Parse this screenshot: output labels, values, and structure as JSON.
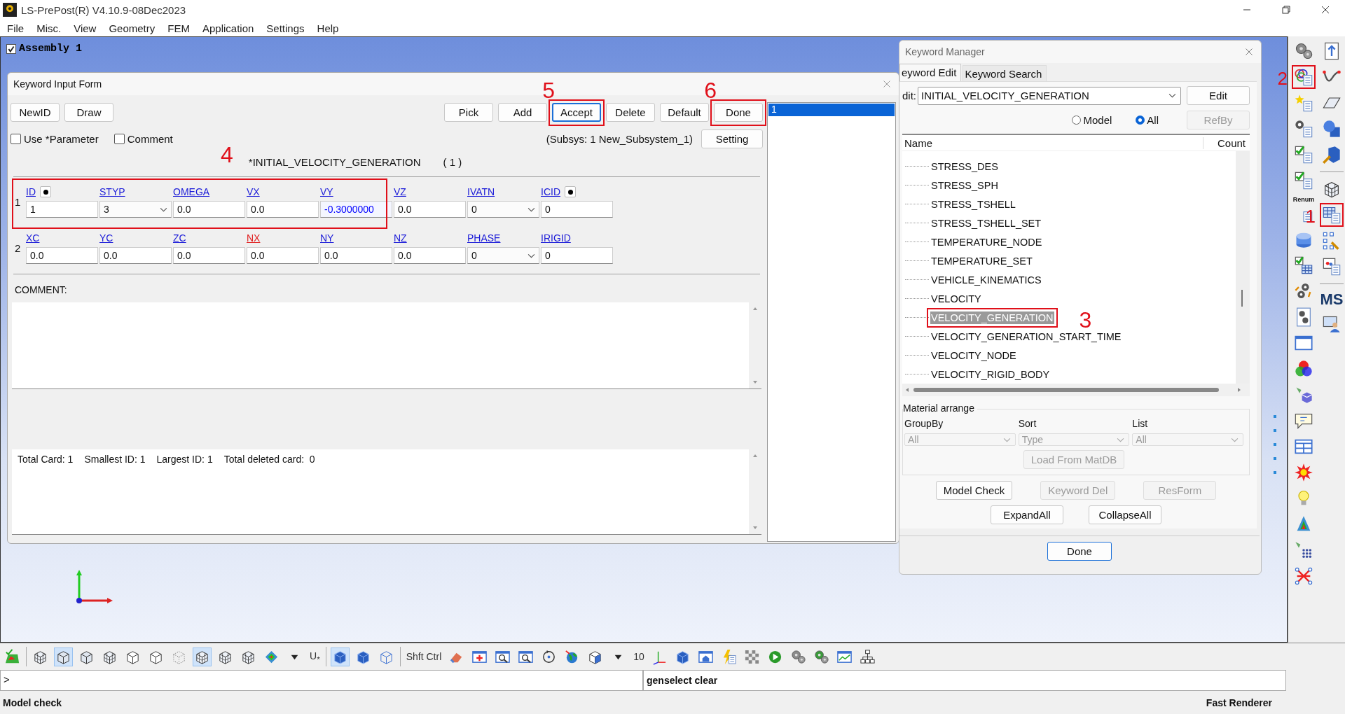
{
  "window": {
    "title": "LS-PrePost(R) V4.10.9-08Dec2023"
  },
  "menu": [
    "File",
    "Misc.",
    "View",
    "Geometry",
    "FEM",
    "Application",
    "Settings",
    "Help"
  ],
  "assembly_tree": {
    "label": "Assembly 1",
    "checked": true
  },
  "keyword_input_form": {
    "title": "Keyword Input Form",
    "left_buttons": [
      {
        "label": "NewID"
      },
      {
        "label": "Draw"
      }
    ],
    "action_buttons": [
      {
        "label": "Pick",
        "focused": false
      },
      {
        "label": "Add",
        "focused": false
      },
      {
        "label": "Accept",
        "focused": true,
        "callout": "5"
      },
      {
        "label": "Delete",
        "focused": false
      },
      {
        "label": "Default",
        "focused": false
      },
      {
        "label": "Done",
        "focused": false,
        "callout": "6"
      }
    ],
    "options": [
      {
        "label": "Use *Parameter",
        "checked": false
      },
      {
        "label": "Comment",
        "checked": false
      }
    ],
    "subsystem": "(Subsys: 1 New_Subsystem_1)",
    "setting_button": "Setting",
    "keyword_title": "*INITIAL_VELOCITY_GENERATION",
    "keyword_count": "( 1 )",
    "cards_callout": "4",
    "cards": [
      {
        "number": "1",
        "fields": [
          {
            "name": "ID",
            "kind": "text",
            "value": "1",
            "pick": true,
            "required": false,
            "modified": false
          },
          {
            "name": "STYP",
            "kind": "select",
            "value": "3",
            "pick": false,
            "required": false,
            "modified": false
          },
          {
            "name": "OMEGA",
            "kind": "text",
            "value": "0.0",
            "pick": false,
            "required": false,
            "modified": false
          },
          {
            "name": "VX",
            "kind": "text",
            "value": "0.0",
            "pick": false,
            "required": false,
            "modified": false
          },
          {
            "name": "VY",
            "kind": "text",
            "value": "-0.3000000",
            "pick": false,
            "required": false,
            "modified": true
          },
          {
            "name": "VZ",
            "kind": "text",
            "value": "0.0",
            "pick": false,
            "required": false,
            "modified": false
          },
          {
            "name": "IVATN",
            "kind": "select",
            "value": "0",
            "pick": false,
            "required": false,
            "modified": false
          },
          {
            "name": "ICID",
            "kind": "text",
            "value": "0",
            "pick": true,
            "required": false,
            "modified": false
          }
        ]
      },
      {
        "number": "2",
        "fields": [
          {
            "name": "XC",
            "kind": "text",
            "value": "0.0",
            "pick": false,
            "required": false,
            "modified": false
          },
          {
            "name": "YC",
            "kind": "text",
            "value": "0.0",
            "pick": false,
            "required": false,
            "modified": false
          },
          {
            "name": "ZC",
            "kind": "text",
            "value": "0.0",
            "pick": false,
            "required": false,
            "modified": false
          },
          {
            "name": "NX",
            "kind": "text",
            "value": "0.0",
            "pick": false,
            "required": true,
            "modified": false
          },
          {
            "name": "NY",
            "kind": "text",
            "value": "0.0",
            "pick": false,
            "required": false,
            "modified": false
          },
          {
            "name": "NZ",
            "kind": "text",
            "value": "0.0",
            "pick": false,
            "required": false,
            "modified": false
          },
          {
            "name": "PHASE",
            "kind": "select",
            "value": "0",
            "pick": false,
            "required": false,
            "modified": false
          },
          {
            "name": "IRIGID",
            "kind": "text",
            "value": "0",
            "pick": false,
            "required": false,
            "modified": false
          }
        ]
      }
    ],
    "comment_label": "COMMENT:",
    "summary": [
      "Total Card: 1",
      "Smallest ID: 1",
      "Largest ID: 1",
      "Total deleted card:  0"
    ],
    "id_list": [
      {
        "label": "1",
        "selected": true
      }
    ]
  },
  "keyword_manager": {
    "title": "Keyword Manager",
    "tabs": [
      {
        "label": "eyword Edit",
        "selected": true
      },
      {
        "label": "Keyword Search",
        "selected": false
      }
    ],
    "edit_label": "dit:",
    "edit_value": "INITIAL_VELOCITY_GENERATION",
    "edit_button": "Edit",
    "scope": [
      {
        "label": "Model",
        "selected": false
      },
      {
        "label": "All",
        "selected": true
      }
    ],
    "refby_button": {
      "label": "RefBy",
      "disabled": true
    },
    "columns": [
      "Name",
      "Count"
    ],
    "items": [
      {
        "name": "STRESS_DES",
        "selected": false
      },
      {
        "name": "STRESS_SPH",
        "selected": false
      },
      {
        "name": "STRESS_TSHELL",
        "selected": false
      },
      {
        "name": "STRESS_TSHELL_SET",
        "selected": false
      },
      {
        "name": "TEMPERATURE_NODE",
        "selected": false
      },
      {
        "name": "TEMPERATURE_SET",
        "selected": false
      },
      {
        "name": "VEHICLE_KINEMATICS",
        "selected": false
      },
      {
        "name": "VELOCITY",
        "selected": false
      },
      {
        "name": "VELOCITY_GENERATION",
        "selected": true,
        "callout": "3"
      },
      {
        "name": "VELOCITY_GENERATION_START_TIME",
        "selected": false
      },
      {
        "name": "VELOCITY_NODE",
        "selected": false
      },
      {
        "name": "VELOCITY_RIGID_BODY",
        "selected": false
      }
    ],
    "material_arrange": {
      "title": "Material arrange",
      "filters": [
        {
          "label": "GroupBy",
          "value": "All",
          "disabled": true
        },
        {
          "label": "Sort",
          "value": "Type",
          "disabled": true
        },
        {
          "label": "List",
          "value": "All",
          "disabled": true
        }
      ],
      "load_button": {
        "label": "Load From MatDB",
        "disabled": true
      }
    },
    "button_rows": [
      [
        {
          "label": "Model Check",
          "disabled": false
        },
        {
          "label": "Keyword Del",
          "disabled": true
        },
        {
          "label": "ResForm",
          "disabled": true
        }
      ],
      [
        {
          "label": "ExpandAll",
          "disabled": false
        },
        {
          "label": "CollapseAll",
          "disabled": false
        }
      ]
    ],
    "done_button": "Done"
  },
  "right_toolbar": {
    "column_1": [
      {
        "kind": "gears"
      },
      {
        "kind": "circles-list",
        "callout": "2"
      },
      {
        "kind": "star-list"
      },
      {
        "kind": "gear-list"
      },
      {
        "kind": "check-list"
      },
      {
        "kind": "check-list"
      },
      {
        "kind": "renum",
        "label": "Renum"
      },
      {
        "kind": "cylinder"
      },
      {
        "kind": "check-grid"
      },
      {
        "kind": "gears-arrows"
      },
      {
        "kind": "gears-panel"
      },
      {
        "kind": "window"
      },
      {
        "kind": "rgb"
      },
      {
        "kind": "lamp-cube"
      },
      {
        "kind": "bubble"
      },
      {
        "kind": "split-window"
      },
      {
        "kind": "explosion"
      },
      {
        "kind": "bulb"
      },
      {
        "kind": "triangle"
      },
      {
        "kind": "lamp-grid"
      },
      {
        "kind": "x-nodes"
      }
    ],
    "column_2": [
      {
        "kind": "up-doc"
      },
      {
        "kind": "curve"
      },
      {
        "kind": "plane"
      },
      {
        "kind": "sphere-cube"
      },
      {
        "kind": "cube-wrench"
      },
      {
        "kind": "separator"
      },
      {
        "kind": "mesh-cube"
      },
      {
        "kind": "table-list",
        "callout": "1"
      },
      {
        "kind": "node-wrench"
      },
      {
        "kind": "photo-list"
      },
      {
        "kind": "separator"
      },
      {
        "kind": "label",
        "label": "MS"
      },
      {
        "kind": "person-screen"
      }
    ]
  },
  "bottom_toolbar": [
    {
      "kind": "surface",
      "selected": false
    },
    {
      "kind": "separator"
    },
    {
      "kind": "mesh-cube",
      "selected": false
    },
    {
      "kind": "shaded-cube",
      "selected": true
    },
    {
      "kind": "shaded-cube",
      "selected": false
    },
    {
      "kind": "mesh-cube",
      "selected": false
    },
    {
      "kind": "outline-cube",
      "selected": false
    },
    {
      "kind": "outline-cube",
      "selected": false
    },
    {
      "kind": "dots-cube",
      "selected": false
    },
    {
      "kind": "mesh-cube",
      "selected": true
    },
    {
      "kind": "mesh-cube",
      "selected": false
    },
    {
      "kind": "mesh-cube",
      "selected": false
    },
    {
      "kind": "fringe",
      "selected": false
    },
    {
      "kind": "caret",
      "selected": false
    },
    {
      "kind": "label",
      "label": "U$_{*}$",
      "selected": false
    },
    {
      "kind": "separator"
    },
    {
      "kind": "blue-cube",
      "selected": true
    },
    {
      "kind": "blue-cube",
      "selected": false
    },
    {
      "kind": "wire-cube",
      "selected": false
    },
    {
      "kind": "separator"
    },
    {
      "kind": "label",
      "label": "Shft Ctrl",
      "selected": false
    },
    {
      "kind": "eraser",
      "selected": false
    },
    {
      "kind": "plus-window",
      "selected": false
    },
    {
      "kind": "zoom-window",
      "selected": false
    },
    {
      "kind": "zoom-window",
      "selected": false
    },
    {
      "kind": "rotate",
      "selected": false
    },
    {
      "kind": "globe",
      "selected": false
    },
    {
      "kind": "view-cube",
      "selected": false
    },
    {
      "kind": "caret",
      "selected": false
    },
    {
      "kind": "label",
      "label": "10",
      "selected": false
    },
    {
      "kind": "axis",
      "selected": false
    },
    {
      "kind": "blue-cube",
      "selected": false
    },
    {
      "kind": "home",
      "selected": false
    },
    {
      "kind": "flash-list",
      "selected": false
    },
    {
      "kind": "checker",
      "selected": false
    },
    {
      "kind": "play",
      "selected": false
    },
    {
      "kind": "gears",
      "selected": false
    },
    {
      "kind": "gears-green",
      "selected": false
    },
    {
      "kind": "chart",
      "selected": false
    },
    {
      "kind": "tree",
      "selected": false
    }
  ],
  "command_line": {
    "prompt": ">",
    "output": "genselect clear"
  },
  "status_bar": {
    "message": "Model check",
    "renderer": "Fast Renderer"
  }
}
